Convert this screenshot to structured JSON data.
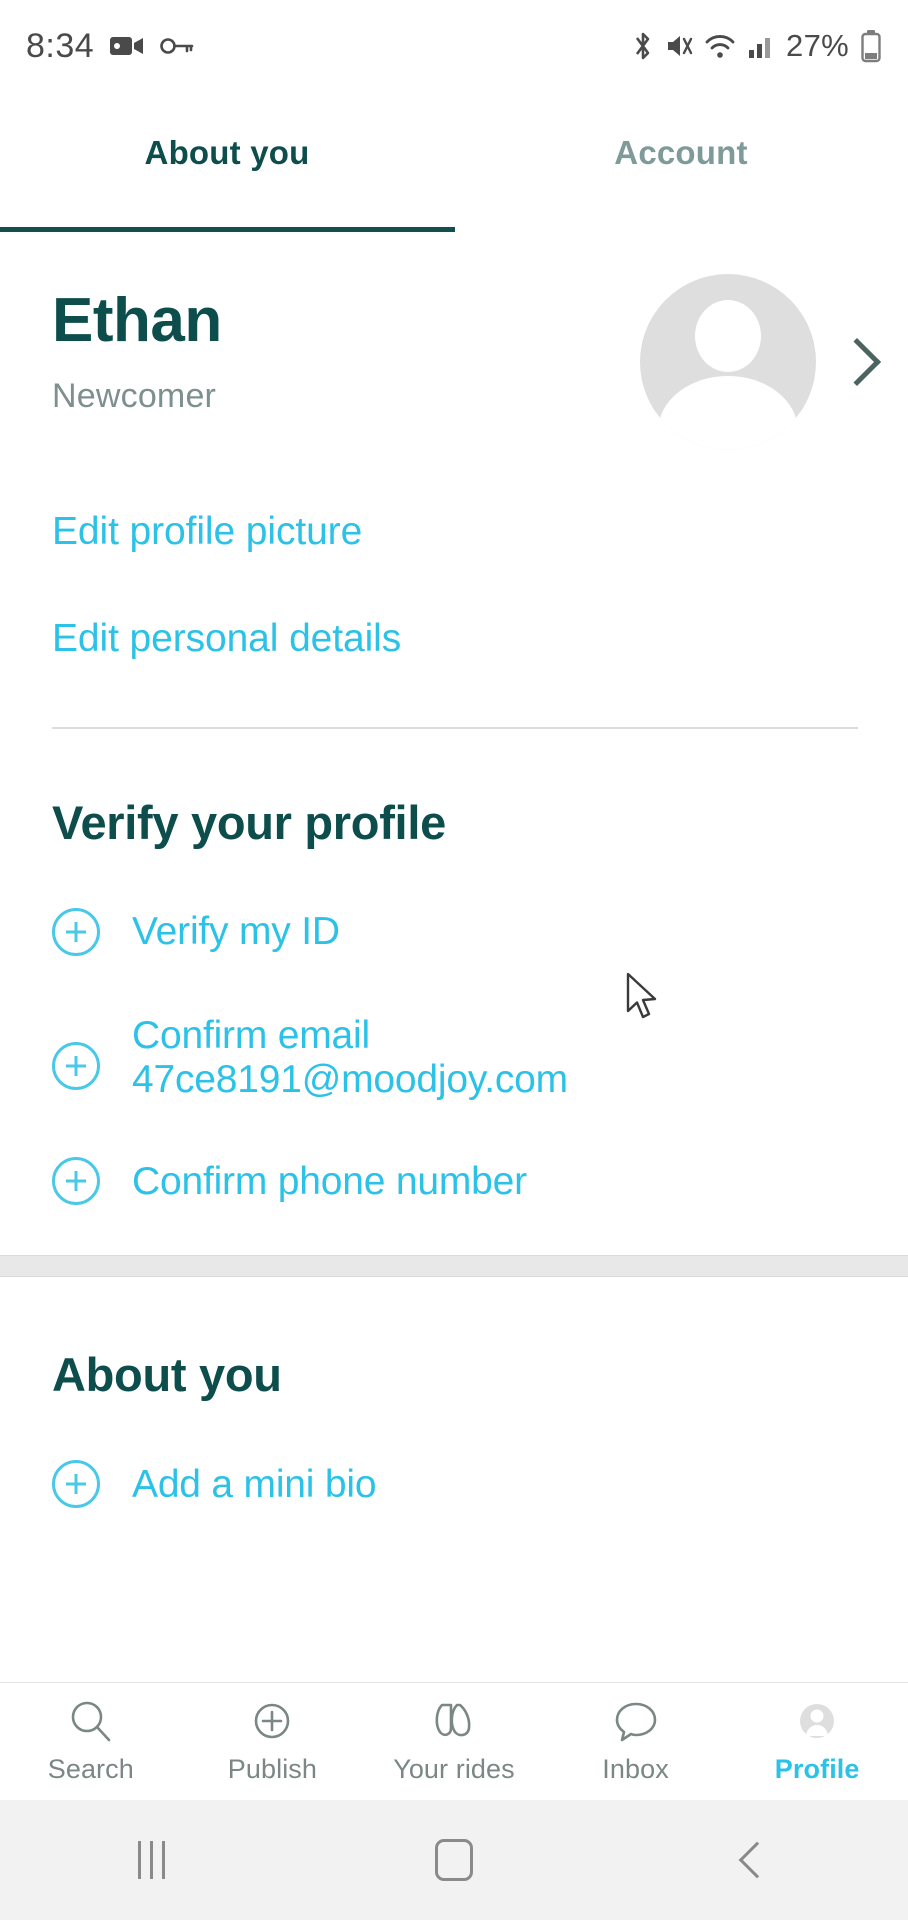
{
  "status_bar": {
    "time": "8:34",
    "battery_percent": "27%",
    "left_icons": [
      "video-record-icon",
      "key-icon"
    ],
    "right_icons": [
      "bluetooth-icon",
      "mute-icon",
      "wifi-icon",
      "cellular-signal-icon",
      "battery-icon"
    ]
  },
  "tabs": {
    "active_index": 0,
    "items": [
      {
        "label": "About you"
      },
      {
        "label": "Account"
      }
    ]
  },
  "profile": {
    "name": "Ethan",
    "status": "Newcomer",
    "avatar_icon": "person-placeholder-icon",
    "chevron_icon": "chevron-right-icon",
    "links": [
      {
        "label": "Edit profile picture"
      },
      {
        "label": "Edit personal details"
      }
    ]
  },
  "verify_section": {
    "title": "Verify your profile",
    "items": [
      {
        "label": "Verify my ID",
        "icon": "plus-circle-icon"
      },
      {
        "label": "Confirm email 47ce8191@moodjoy.com",
        "icon": "plus-circle-icon"
      },
      {
        "label": "Confirm phone number",
        "icon": "plus-circle-icon"
      }
    ]
  },
  "about_section": {
    "title": "About you",
    "items": [
      {
        "label": "Add a mini bio",
        "icon": "plus-circle-icon"
      }
    ]
  },
  "bottom_nav": {
    "active_index": 4,
    "items": [
      {
        "label": "Search",
        "icon": "search-icon"
      },
      {
        "label": "Publish",
        "icon": "plus-circle-icon"
      },
      {
        "label": "Your rides",
        "icon": "rides-icon"
      },
      {
        "label": "Inbox",
        "icon": "chat-bubble-icon"
      },
      {
        "label": "Profile",
        "icon": "person-icon"
      }
    ]
  },
  "system_nav": {
    "recents_icon": "recents-icon",
    "home_icon": "home-icon",
    "back_icon": "back-icon"
  },
  "colors": {
    "accent_cyan": "#2cc2e8",
    "brand_teal": "#0d4e4d",
    "muted_gray": "#7d8f8e"
  }
}
